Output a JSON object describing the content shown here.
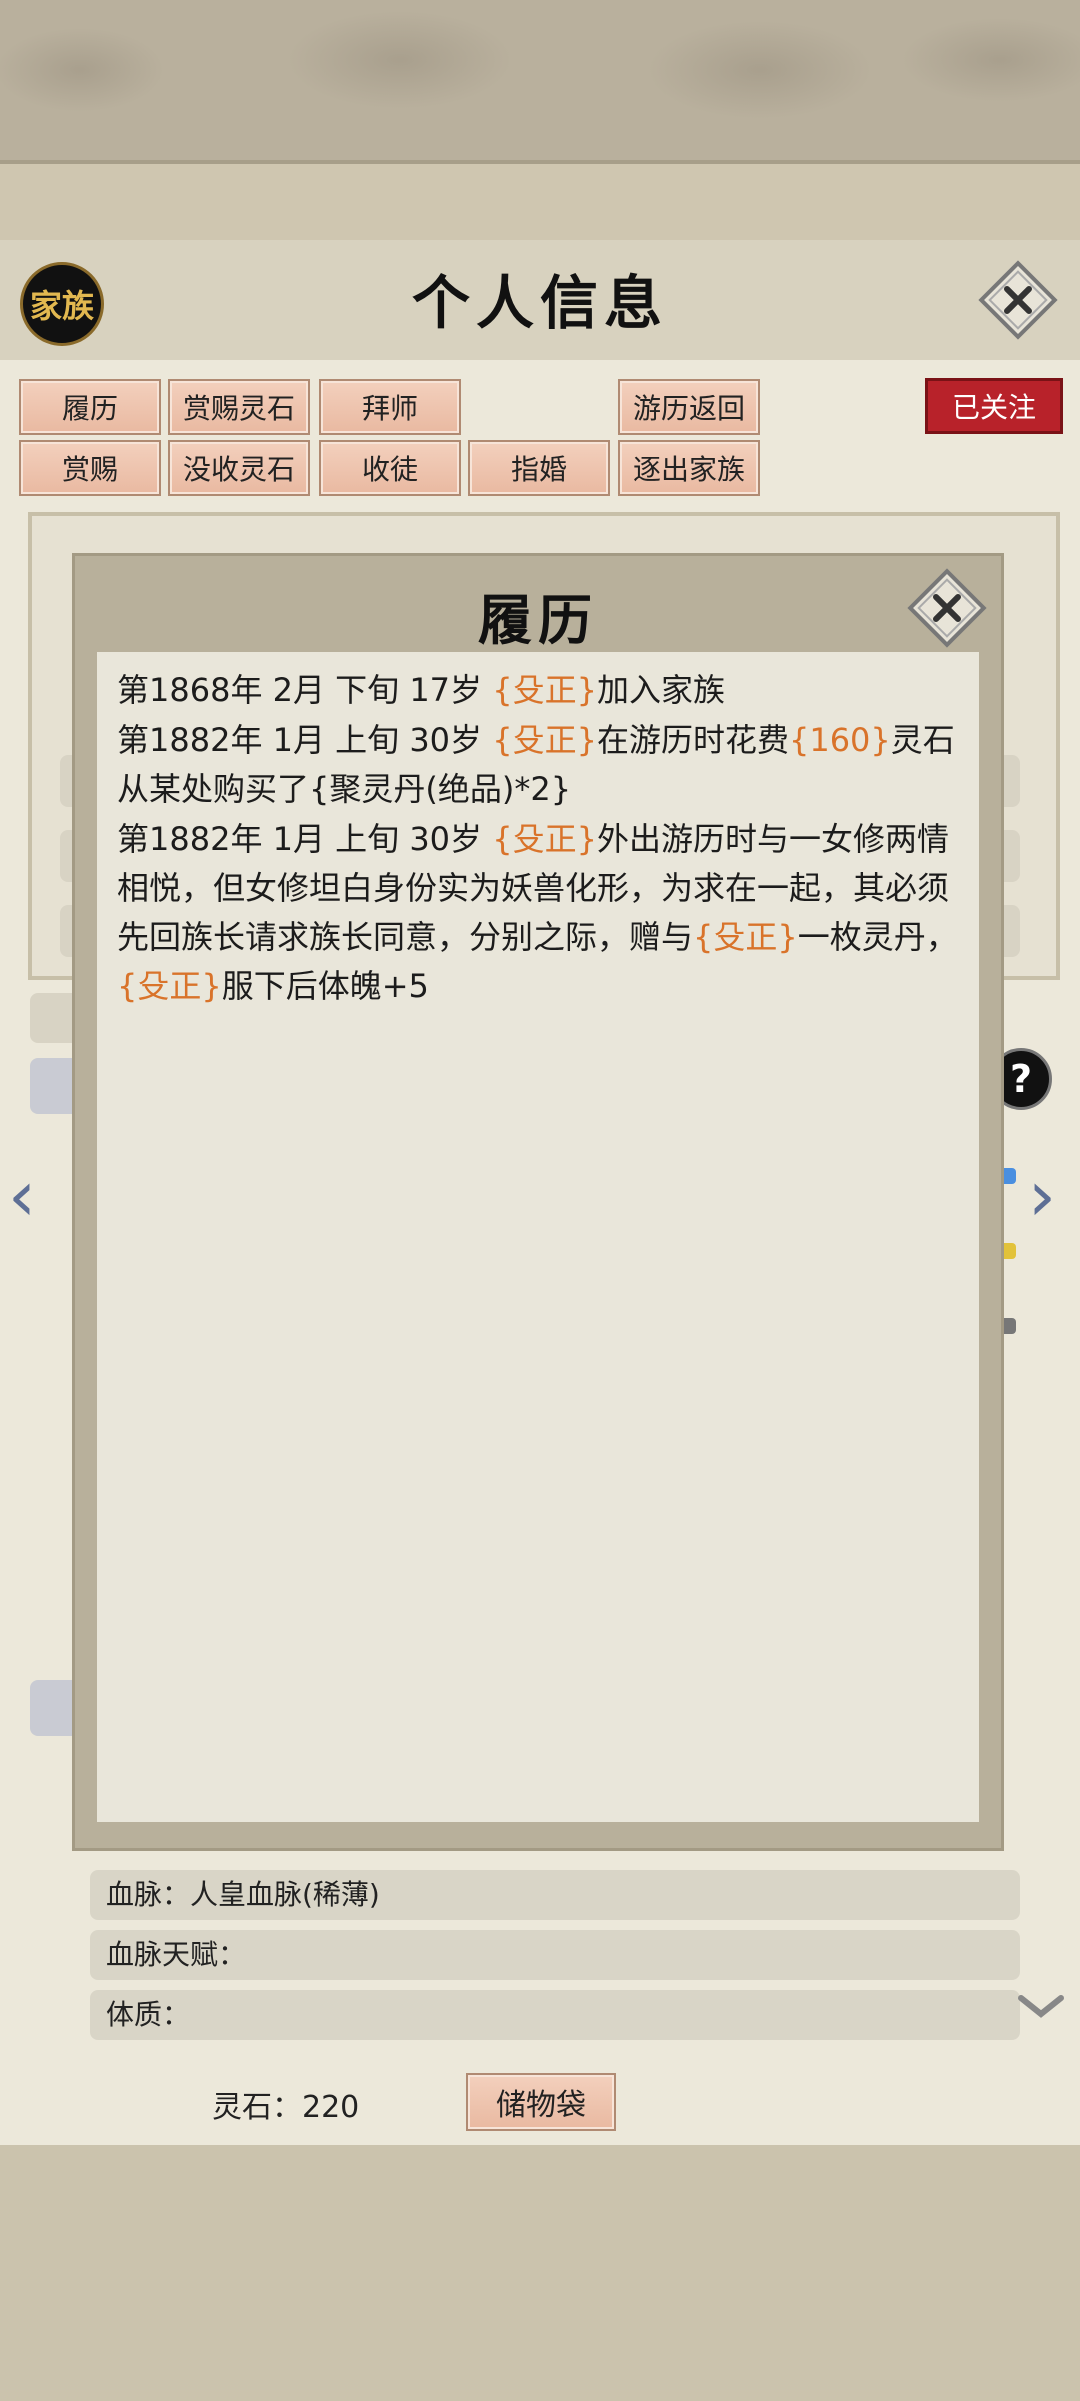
{
  "header": {
    "clan_badge": "家族",
    "title": "个人信息"
  },
  "buttons": {
    "row1": [
      "履历",
      "赏赐灵石",
      "拜师",
      "游历返回"
    ],
    "row2": [
      "赏赐",
      "没收灵石",
      "收徒",
      "指婚",
      "逐出家族"
    ],
    "follow": "已关注"
  },
  "modal": {
    "title": "履历",
    "entries": [
      {
        "prefix": "第1868年 2月 下旬  17岁 ",
        "hl1": "{殳正}",
        "mid1": "加入家族",
        "hl2": "",
        "mid2": "",
        "hl3": "",
        "suffix": ""
      },
      {
        "prefix": "第1882年 1月 上旬  30岁 ",
        "hl1": "{殳正}",
        "mid1": "在游历时花费",
        "hl2": "{160}",
        "mid2": "灵石从某处购买了{聚灵丹(绝品)*2}",
        "hl3": "",
        "suffix": ""
      },
      {
        "prefix": "第1882年 1月 上旬 30岁 ",
        "hl1": "{殳正}",
        "mid1": "外出游历时与一女修两情相悦，但女修坦白身份实为妖兽化形，为求在一起，其必须先回族长请求族长同意，分别之际，赠与",
        "hl2": "{殳正}",
        "mid2": "一枚灵丹，",
        "hl3": "{殳正}",
        "suffix": "服下后体魄+5"
      }
    ]
  },
  "info_rows": {
    "bloodline": "血脉：人皇血脉(稀薄)",
    "bloodline_talent": "血脉天赋：",
    "constitution": "体质："
  },
  "footer": {
    "spirit_stones": "灵石：220",
    "bag_button": "储物袋"
  },
  "colors": {
    "highlight": "#d9732a",
    "button_fill": "#efc5ae",
    "follow_button": "#b8222a"
  },
  "icons": [
    "close-icon",
    "help-icon",
    "arrow-left-icon",
    "arrow-right-icon",
    "chevron-down-icon"
  ]
}
